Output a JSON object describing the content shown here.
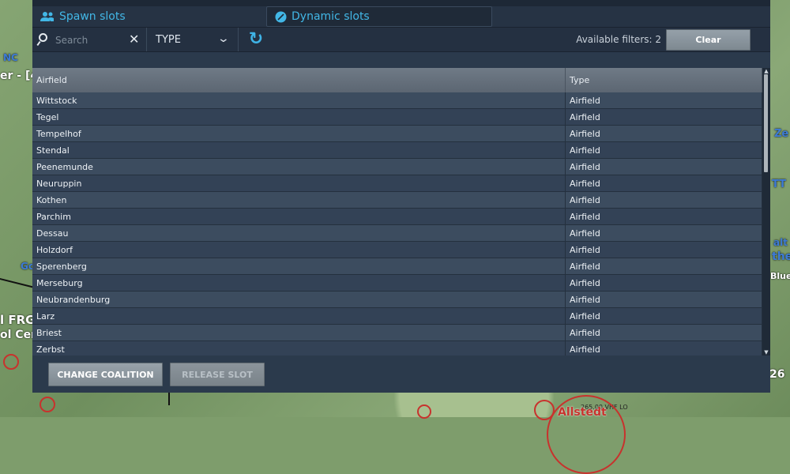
{
  "tabs": {
    "spawn_label": "Spawn slots",
    "dynamic_label": "Dynamic slots"
  },
  "filters": {
    "search_placeholder": "Search",
    "search_value": "",
    "type_label": "TYPE",
    "available_text": "Available filters: 2",
    "clear_label": "Clear"
  },
  "table": {
    "headers": [
      "Airfield",
      "Type"
    ],
    "rows": [
      [
        "Wittstock",
        "Airfield"
      ],
      [
        "Tegel",
        "Airfield"
      ],
      [
        "Tempelhof",
        "Airfield"
      ],
      [
        "Stendal",
        "Airfield"
      ],
      [
        "Peenemunde",
        "Airfield"
      ],
      [
        "Neuruppin",
        "Airfield"
      ],
      [
        "Kothen",
        "Airfield"
      ],
      [
        "Parchim",
        "Airfield"
      ],
      [
        "Dessau",
        "Airfield"
      ],
      [
        "Holzdorf",
        "Airfield"
      ],
      [
        "Sperenberg",
        "Airfield"
      ],
      [
        "Merseburg",
        "Airfield"
      ],
      [
        "Neubrandenburg",
        "Airfield"
      ],
      [
        "Larz",
        "Airfield"
      ],
      [
        "Briest",
        "Airfield"
      ],
      [
        "Zerbst",
        "Airfield"
      ]
    ]
  },
  "footer": {
    "change_coalition_label": "CHANGE COALITION",
    "release_slot_label": "RELEASE SLOT"
  },
  "map_labels": {
    "left_1": "NC",
    "left_2": "er - [4",
    "left_3": "Gc",
    "left_4": "l FRG",
    "left_5": "ol Cen",
    "right_1": "Ze",
    "right_2": "TT",
    "right_3": "alt",
    "right_4": "the",
    "right_5": "Blue",
    "right_6": "26",
    "bottom_freq": "265.00 VHF LO",
    "bottom_place": "Allstedt"
  },
  "icons": {
    "spawn": "users-icon",
    "dynamic": "leaf-icon",
    "search": "search-icon",
    "clear": "close-icon",
    "type_chevron": "chevron-down-icon",
    "refresh": "refresh-icon"
  },
  "colors": {
    "accent": "#42b7e6",
    "panel": "#2b3a4c"
  }
}
